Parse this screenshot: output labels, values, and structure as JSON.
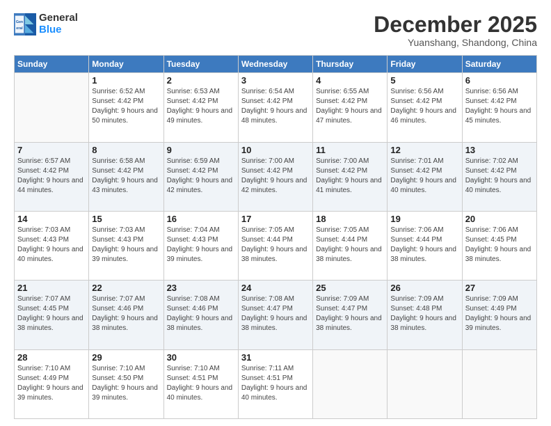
{
  "logo": {
    "general": "General",
    "blue": "Blue"
  },
  "title": "December 2025",
  "location": "Yuanshang, Shandong, China",
  "headers": [
    "Sunday",
    "Monday",
    "Tuesday",
    "Wednesday",
    "Thursday",
    "Friday",
    "Saturday"
  ],
  "weeks": [
    [
      {
        "day": "",
        "empty": true
      },
      {
        "day": "1",
        "sunrise": "6:52 AM",
        "sunset": "4:42 PM",
        "daylight": "9 hours and 50 minutes."
      },
      {
        "day": "2",
        "sunrise": "6:53 AM",
        "sunset": "4:42 PM",
        "daylight": "9 hours and 49 minutes."
      },
      {
        "day": "3",
        "sunrise": "6:54 AM",
        "sunset": "4:42 PM",
        "daylight": "9 hours and 48 minutes."
      },
      {
        "day": "4",
        "sunrise": "6:55 AM",
        "sunset": "4:42 PM",
        "daylight": "9 hours and 47 minutes."
      },
      {
        "day": "5",
        "sunrise": "6:56 AM",
        "sunset": "4:42 PM",
        "daylight": "9 hours and 46 minutes."
      },
      {
        "day": "6",
        "sunrise": "6:56 AM",
        "sunset": "4:42 PM",
        "daylight": "9 hours and 45 minutes."
      }
    ],
    [
      {
        "day": "7",
        "sunrise": "6:57 AM",
        "sunset": "4:42 PM",
        "daylight": "9 hours and 44 minutes."
      },
      {
        "day": "8",
        "sunrise": "6:58 AM",
        "sunset": "4:42 PM",
        "daylight": "9 hours and 43 minutes."
      },
      {
        "day": "9",
        "sunrise": "6:59 AM",
        "sunset": "4:42 PM",
        "daylight": "9 hours and 42 minutes."
      },
      {
        "day": "10",
        "sunrise": "7:00 AM",
        "sunset": "4:42 PM",
        "daylight": "9 hours and 42 minutes."
      },
      {
        "day": "11",
        "sunrise": "7:00 AM",
        "sunset": "4:42 PM",
        "daylight": "9 hours and 41 minutes."
      },
      {
        "day": "12",
        "sunrise": "7:01 AM",
        "sunset": "4:42 PM",
        "daylight": "9 hours and 40 minutes."
      },
      {
        "day": "13",
        "sunrise": "7:02 AM",
        "sunset": "4:42 PM",
        "daylight": "9 hours and 40 minutes."
      }
    ],
    [
      {
        "day": "14",
        "sunrise": "7:03 AM",
        "sunset": "4:43 PM",
        "daylight": "9 hours and 40 minutes."
      },
      {
        "day": "15",
        "sunrise": "7:03 AM",
        "sunset": "4:43 PM",
        "daylight": "9 hours and 39 minutes."
      },
      {
        "day": "16",
        "sunrise": "7:04 AM",
        "sunset": "4:43 PM",
        "daylight": "9 hours and 39 minutes."
      },
      {
        "day": "17",
        "sunrise": "7:05 AM",
        "sunset": "4:44 PM",
        "daylight": "9 hours and 38 minutes."
      },
      {
        "day": "18",
        "sunrise": "7:05 AM",
        "sunset": "4:44 PM",
        "daylight": "9 hours and 38 minutes."
      },
      {
        "day": "19",
        "sunrise": "7:06 AM",
        "sunset": "4:44 PM",
        "daylight": "9 hours and 38 minutes."
      },
      {
        "day": "20",
        "sunrise": "7:06 AM",
        "sunset": "4:45 PM",
        "daylight": "9 hours and 38 minutes."
      }
    ],
    [
      {
        "day": "21",
        "sunrise": "7:07 AM",
        "sunset": "4:45 PM",
        "daylight": "9 hours and 38 minutes."
      },
      {
        "day": "22",
        "sunrise": "7:07 AM",
        "sunset": "4:46 PM",
        "daylight": "9 hours and 38 minutes."
      },
      {
        "day": "23",
        "sunrise": "7:08 AM",
        "sunset": "4:46 PM",
        "daylight": "9 hours and 38 minutes."
      },
      {
        "day": "24",
        "sunrise": "7:08 AM",
        "sunset": "4:47 PM",
        "daylight": "9 hours and 38 minutes."
      },
      {
        "day": "25",
        "sunrise": "7:09 AM",
        "sunset": "4:47 PM",
        "daylight": "9 hours and 38 minutes."
      },
      {
        "day": "26",
        "sunrise": "7:09 AM",
        "sunset": "4:48 PM",
        "daylight": "9 hours and 38 minutes."
      },
      {
        "day": "27",
        "sunrise": "7:09 AM",
        "sunset": "4:49 PM",
        "daylight": "9 hours and 39 minutes."
      }
    ],
    [
      {
        "day": "28",
        "sunrise": "7:10 AM",
        "sunset": "4:49 PM",
        "daylight": "9 hours and 39 minutes."
      },
      {
        "day": "29",
        "sunrise": "7:10 AM",
        "sunset": "4:50 PM",
        "daylight": "9 hours and 39 minutes."
      },
      {
        "day": "30",
        "sunrise": "7:10 AM",
        "sunset": "4:51 PM",
        "daylight": "9 hours and 40 minutes."
      },
      {
        "day": "31",
        "sunrise": "7:11 AM",
        "sunset": "4:51 PM",
        "daylight": "9 hours and 40 minutes."
      },
      {
        "day": "",
        "empty": true
      },
      {
        "day": "",
        "empty": true
      },
      {
        "day": "",
        "empty": true
      }
    ]
  ],
  "labels": {
    "sunrise_prefix": "Sunrise: ",
    "sunset_prefix": "Sunset: ",
    "daylight_prefix": "Daylight: "
  }
}
